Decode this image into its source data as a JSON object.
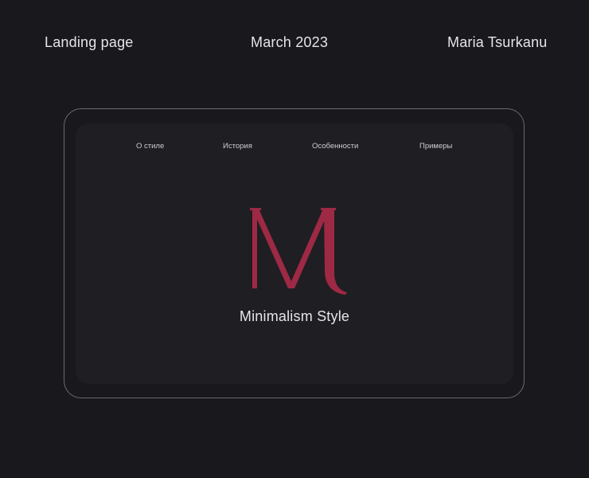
{
  "header": {
    "left": "Landing page",
    "center": "March 2023",
    "right": "Maria Tsurkanu"
  },
  "nav": {
    "items": [
      "О стиле",
      "История",
      "Особенности",
      "Примеры"
    ]
  },
  "hero": {
    "logo_icon": "letter-m-logo",
    "logo_letter": "M",
    "caption": "Minimalism Style"
  },
  "colors": {
    "background": "#19181c",
    "screen": "#1f1e22",
    "accent": "#9e2945",
    "frame_border": "#6c6a70",
    "text": "#e6e4e8"
  }
}
